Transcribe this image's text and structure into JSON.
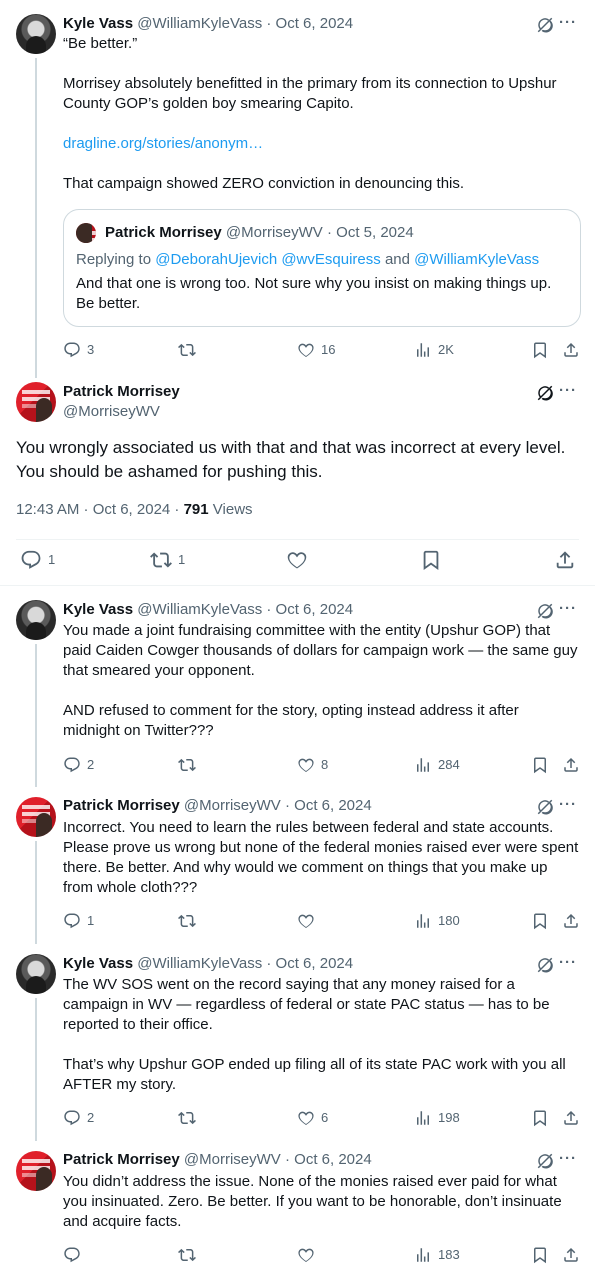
{
  "tweets": [
    {
      "name": "Kyle Vass",
      "handle": "@WilliamKyleVass",
      "date": "Oct 6, 2024",
      "paragraphs": [
        "“Be better.”",
        "Morrisey absolutely benefitted in the primary from its connection to Upshur County GOP’s golden boy smearing Capito.",
        "dragline.org/stories/anonym…",
        "That campaign showed ZERO conviction in denouncing this."
      ],
      "replies": "3",
      "reposts": "",
      "likes": "16",
      "views": "2K"
    },
    {
      "name": "Kyle Vass",
      "handle": "@WilliamKyleVass",
      "date": "Oct 6, 2024",
      "paragraphs": [
        "You made a joint fundraising committee with the entity (Upshur GOP) that paid Caiden Cowger thousands of dollars for campaign work — the same guy that smeared your opponent.",
        "AND refused to comment for the story, opting instead address it after midnight on Twitter???"
      ],
      "replies": "2",
      "reposts": "",
      "likes": "8",
      "views": "284"
    },
    {
      "name": "Patrick Morrisey",
      "handle": "@MorriseyWV",
      "date": "Oct 6, 2024",
      "paragraphs": [
        "Incorrect.  You need to learn the rules between federal and state accounts.  Please prove us wrong but none of the federal monies raised ever were spent there. Be better. And why would we comment on things that you make up from whole cloth???"
      ],
      "replies": "1",
      "reposts": "",
      "likes": "",
      "views": "180"
    },
    {
      "name": "Kyle Vass",
      "handle": "@WilliamKyleVass",
      "date": "Oct 6, 2024",
      "paragraphs": [
        "The WV SOS went on the record saying that any money raised for a campaign in WV — regardless of federal or state PAC status — has to be reported to their office.",
        "That’s why Upshur GOP ended up filing all of its state PAC work with you all AFTER my story."
      ],
      "replies": "2",
      "reposts": "",
      "likes": "6",
      "views": "198"
    },
    {
      "name": "Patrick Morrisey",
      "handle": "@MorriseyWV",
      "date": "Oct 6, 2024",
      "paragraphs": [
        "You didn’t address the issue. None of the monies raised ever paid for what you insinuated.  Zero.  Be better.  If you want to be honorable, don’t insinuate and acquire facts."
      ],
      "replies": "",
      "reposts": "",
      "likes": "",
      "views": "183"
    }
  ],
  "quote": {
    "name": "Patrick Morrisey",
    "handle": "@MorriseyWV",
    "date": "Oct 5, 2024",
    "replying_label": "Replying to",
    "replying_to": "@DeborahUjevich @wvEsquiress",
    "replying_and": "and",
    "replying_last": "@WilliamKyleVass",
    "text": "And that one is wrong too.  Not sure why you insist on making things up. Be better."
  },
  "focal": {
    "name": "Patrick Morrisey",
    "handle": "@MorriseyWV",
    "text": "You wrongly associated us with that and that was incorrect at every level.  You should be ashamed for pushing this.",
    "time": "12:43 AM · Oct 6, 2024 ·",
    "views_count": "791",
    "views_label": "Views",
    "replies": "1",
    "reposts": "1"
  },
  "separator": "·",
  "icons": [
    "reply-icon",
    "repost-icon",
    "like-icon",
    "views-icon",
    "bookmark-icon",
    "share-icon",
    "grok-icon",
    "more-icon"
  ],
  "colors": {
    "link": "#1d9bf0",
    "secondary": "#536471",
    "border": "#cfd9de"
  }
}
